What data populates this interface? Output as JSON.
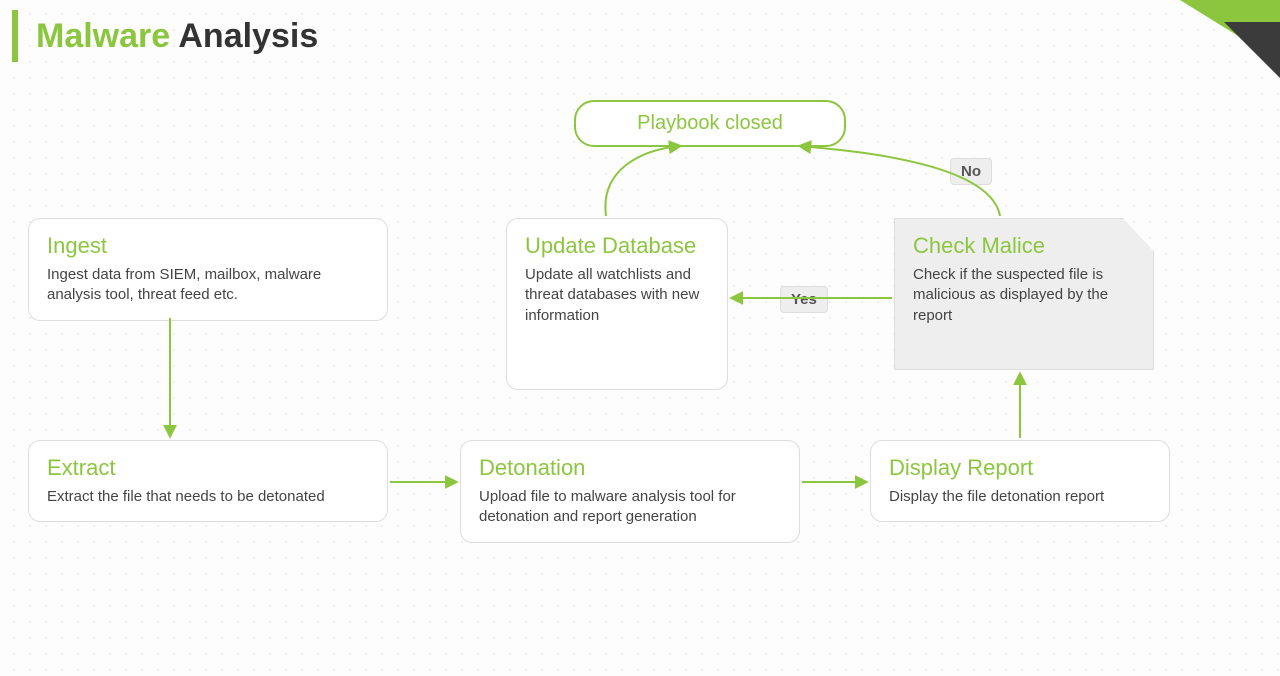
{
  "title": {
    "word1": "Malware",
    "word2": "Analysis"
  },
  "terminal": {
    "closed": "Playbook closed"
  },
  "labels": {
    "yes": "Yes",
    "no": "No"
  },
  "nodes": {
    "ingest": {
      "title": "Ingest",
      "desc": "Ingest data from SIEM, mailbox, malware analysis tool, threat feed etc."
    },
    "extract": {
      "title": "Extract",
      "desc": "Extract the file that needs to be detonated"
    },
    "detonation": {
      "title": "Detonation",
      "desc": "Upload file to malware analysis tool for detonation and report generation"
    },
    "display": {
      "title": "Display Report",
      "desc": "Display the file detonation report"
    },
    "check": {
      "title": "Check Malice",
      "desc": "Check if the suspected file is malicious as displayed by the report"
    },
    "update": {
      "title": "Update Database",
      "desc": "Update all watchlists and threat databases with new information"
    }
  },
  "colors": {
    "accent": "#8cc63f"
  }
}
